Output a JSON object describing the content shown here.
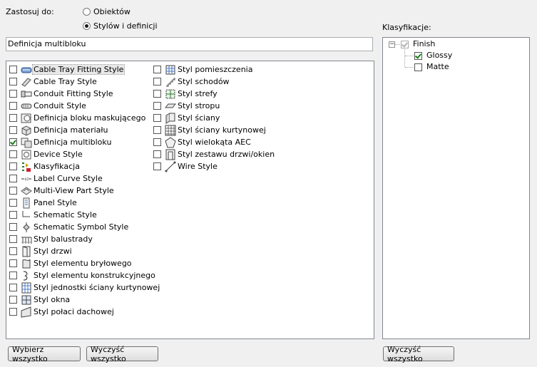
{
  "apply_to": {
    "label": "Zastosuj do:",
    "options": [
      {
        "label": "Obiektów",
        "selected": false
      },
      {
        "label": "Stylów i definicji",
        "selected": true
      }
    ]
  },
  "selected_type_field": {
    "value": "Definicja multibloku"
  },
  "style_list": {
    "col1": [
      {
        "label": "Cable Tray Fitting Style",
        "checked": false,
        "icon": "cable-tray-fitting-icon"
      },
      {
        "label": "Cable Tray Style",
        "checked": false,
        "icon": "cable-tray-icon"
      },
      {
        "label": "Conduit Fitting Style",
        "checked": false,
        "icon": "conduit-fitting-icon"
      },
      {
        "label": "Conduit Style",
        "checked": false,
        "icon": "conduit-icon"
      },
      {
        "label": "Definicja bloku maskującego",
        "checked": false,
        "icon": "mask-block-icon"
      },
      {
        "label": "Definicja materiału",
        "checked": false,
        "icon": "material-icon"
      },
      {
        "label": "Definicja multibloku",
        "checked": true,
        "icon": "multiblock-icon"
      },
      {
        "label": "Device Style",
        "checked": false,
        "icon": "device-icon"
      },
      {
        "label": "Klasyfikacja",
        "checked": false,
        "icon": "classification-icon"
      },
      {
        "label": "Label Curve Style",
        "checked": false,
        "icon": "label-curve-icon"
      },
      {
        "label": "Multi-View Part Style",
        "checked": false,
        "icon": "multiview-part-icon"
      },
      {
        "label": "Panel Style",
        "checked": false,
        "icon": "panel-icon"
      },
      {
        "label": "Schematic Style",
        "checked": false,
        "icon": "schematic-icon"
      },
      {
        "label": "Schematic Symbol Style",
        "checked": false,
        "icon": "schematic-symbol-icon"
      },
      {
        "label": "Styl balustrady",
        "checked": false,
        "icon": "railing-icon"
      },
      {
        "label": "Styl drzwi",
        "checked": false,
        "icon": "door-icon"
      },
      {
        "label": "Styl elementu bryłowego",
        "checked": false,
        "icon": "mass-element-icon"
      },
      {
        "label": "Styl elementu konstrukcyjnego",
        "checked": false,
        "icon": "structural-member-icon"
      },
      {
        "label": "Styl jednostki ściany kurtynowej",
        "checked": false,
        "icon": "curtain-wall-unit-icon"
      },
      {
        "label": "Styl okna",
        "checked": false,
        "icon": "window-icon"
      },
      {
        "label": "Styl połaci dachowej",
        "checked": false,
        "icon": "roof-slab-icon"
      }
    ],
    "col2": [
      {
        "label": "Styl pomieszczenia",
        "checked": false,
        "icon": "space-icon"
      },
      {
        "label": "Styl schodów",
        "checked": false,
        "icon": "stair-icon"
      },
      {
        "label": "Styl strefy",
        "checked": false,
        "icon": "zone-icon"
      },
      {
        "label": "Styl stropu",
        "checked": false,
        "icon": "slab-icon"
      },
      {
        "label": "Styl ściany",
        "checked": false,
        "icon": "wall-icon"
      },
      {
        "label": "Styl ściany kurtynowej",
        "checked": false,
        "icon": "curtain-wall-icon"
      },
      {
        "label": "Styl wielokąta AEC",
        "checked": false,
        "icon": "polygon-icon"
      },
      {
        "label": "Styl zestawu drzwi/okien",
        "checked": false,
        "icon": "door-window-assembly-icon"
      },
      {
        "label": "Wire Style",
        "checked": false,
        "icon": "wire-icon"
      }
    ]
  },
  "classifications": {
    "label": "Klasyfikacje:",
    "root": {
      "label": "Finish",
      "checked": true
    },
    "children": [
      {
        "label": "Glossy",
        "checked": true
      },
      {
        "label": "Matte",
        "checked": false
      }
    ]
  },
  "buttons": {
    "select_all": "Wybierz wszystko",
    "clear_all": "Wyczyść wszystko",
    "clear_all_class": "Wyczyść wszystko"
  }
}
